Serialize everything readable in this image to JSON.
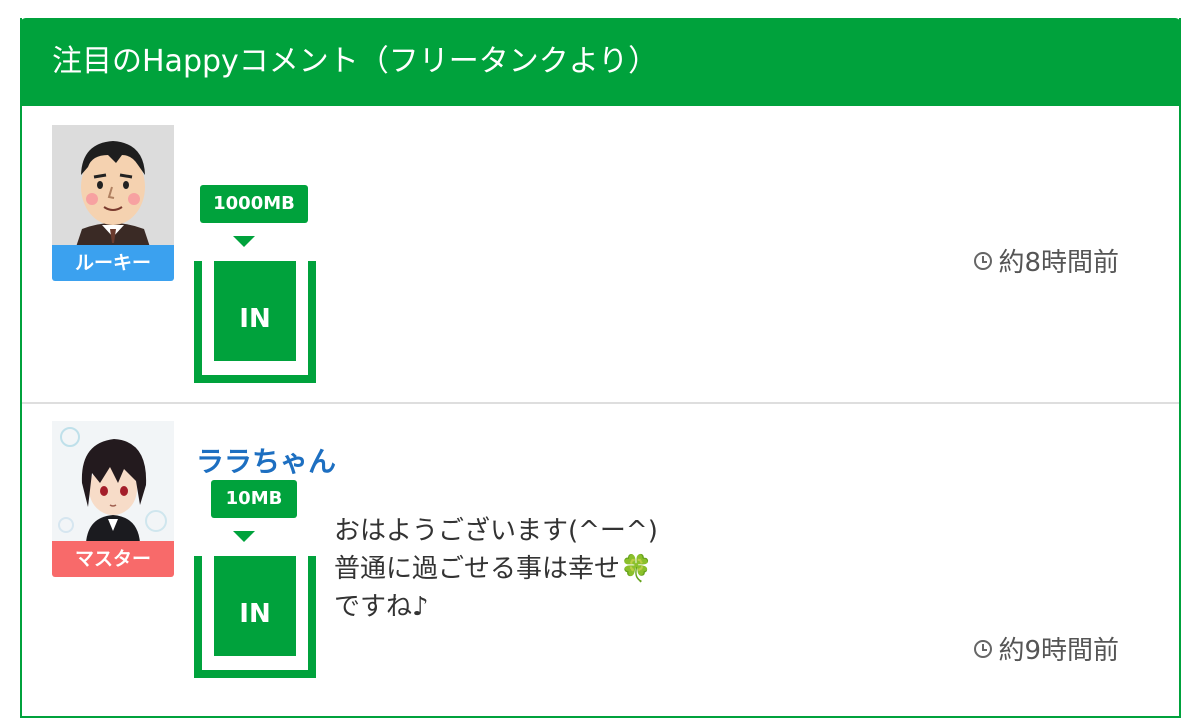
{
  "header": {
    "title": "注目のHappyコメント（フリータンクより）"
  },
  "colors": {
    "brand_green": "#00a23c",
    "rookie_blue": "#3ba1ef",
    "master_red": "#f86a6a",
    "username_blue": "#1d6fc1"
  },
  "comments": [
    {
      "username": "",
      "rank": "ルーキー",
      "amount": "1000MB",
      "tank_label": "IN",
      "text_lines": [],
      "time": "約8時間前"
    },
    {
      "username": "ララちゃん",
      "rank": "マスター",
      "amount": "10MB",
      "tank_label": "IN",
      "text_lines": [
        "おはようございます(^ー^)",
        "普通に過ごせる事は幸せ🍀",
        "ですね♪"
      ],
      "time": "約9時間前"
    }
  ]
}
